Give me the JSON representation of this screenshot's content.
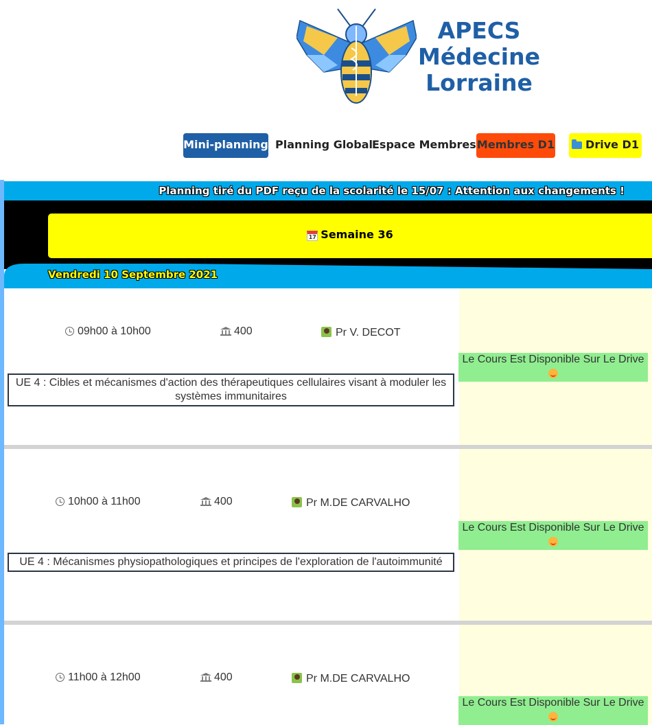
{
  "brand": {
    "line1": "APECS",
    "line2": "Médecine",
    "line3": "Lorraine"
  },
  "nav": {
    "mini_planning": "Mini-planning",
    "planning_global": "Planning Global",
    "espace_membres": "Espace Membres",
    "membres_d1": "Membres D1",
    "drive_d1": "Drive D1"
  },
  "notice": "Planning tiré du PDF reçu de la scolarité le 15/07 : Attention aux changements !",
  "week": {
    "label": "Semaine 36",
    "cal_day": "17"
  },
  "day": "Vendredi 10 Septembre 2021",
  "courses": [
    {
      "time": "09h00 à 10h00",
      "room": "400",
      "prof": "Pr V. DECOT",
      "title": "UE 4 : Cibles et mécanismes d'action des thérapeutiques cellulaires visant à moduler les systèmes immunitaires",
      "status": "Le Cours Est Disponible Sur Le Drive"
    },
    {
      "time": "10h00 à 11h00",
      "room": "400",
      "prof": "Pr M.DE CARVALHO",
      "title": "UE 4 : Mécanismes physiopathologiques et principes de l'exploration de l'autoimmunité",
      "status": "Le Cours Est Disponible Sur Le Drive"
    },
    {
      "time": "11h00 à 12h00",
      "room": "400",
      "prof": "Pr M.DE CARVALHO",
      "title": "",
      "status": "Le Cours Est Disponible Sur Le Drive"
    }
  ],
  "colors": {
    "primary": "#1f5fa6",
    "band": "#00a9ea",
    "week_bg": "#ffff00",
    "members": "#ff4b0a",
    "available": "#90ee90"
  }
}
